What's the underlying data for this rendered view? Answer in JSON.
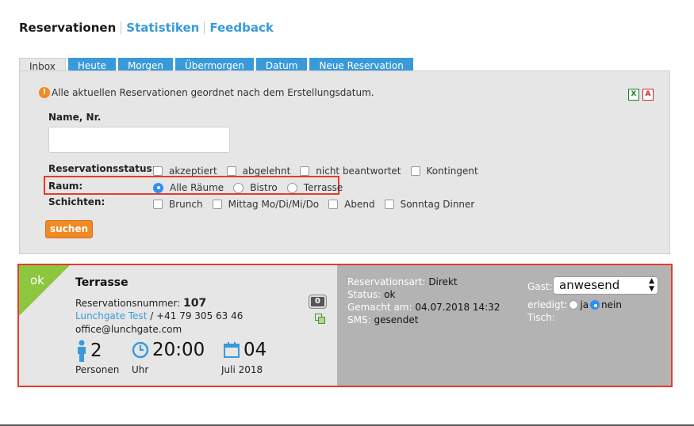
{
  "nav": {
    "items": [
      "Reservationen",
      "Statistiken",
      "Feedback"
    ]
  },
  "tabs": [
    "Inbox",
    "Heute",
    "Morgen",
    "Übermorgen",
    "Datum",
    "Neue Reservation"
  ],
  "filters": {
    "info_text": "Alle aktuellen Reservationen geordnet nach dem Erstellungsdatum.",
    "name_label": "Name, Nr.",
    "name_value": "",
    "status_label": "Reservationsstatus:",
    "status_options": [
      "akzeptiert",
      "abgelehnt",
      "nicht beantwortet",
      "Kontingent"
    ],
    "raum_label": "Raum:",
    "raum_options": [
      "Alle Räume",
      "Bistro",
      "Terrasse"
    ],
    "raum_selected": "Alle Räume",
    "schichten_label": "Schichten:",
    "schichten_options": [
      "Brunch",
      "Mittag Mo/Di/Mi/Do",
      "Abend",
      "Sonntag Dinner"
    ],
    "search_label": "suchen"
  },
  "reservation": {
    "status_badge": "ok",
    "room": "Terrasse",
    "number_label": "Reservationsnummer:",
    "number": "107",
    "guest_name": "Lunchgate Test",
    "phone": " / +41 79 305 63 46",
    "email": "office@lunchgate.com",
    "count_badge": "0",
    "persons": "2",
    "persons_label": "Personen",
    "time": "20:00",
    "time_label": "Uhr",
    "day": "04",
    "month_year": "Juli 2018",
    "details": {
      "art_label": "Reservationsart:",
      "art_value": "Direkt",
      "status_label": "Status:",
      "status_value": "ok",
      "created_label": "Gemacht am:",
      "created_value": "04.07.2018 14:32",
      "sms_label": "SMS:",
      "sms_value": "gesendet"
    },
    "gast_label": "Gast:",
    "gast_value": "anwesend",
    "erledigt_label": "erledigt:",
    "erledigt_options": [
      "ja",
      "nein"
    ],
    "erledigt_selected": "nein",
    "tisch_label": "Tisch:"
  },
  "colors": {
    "accent": "#3a9ad9",
    "ok_green": "#8dc63f",
    "button_orange": "#f08a24",
    "highlight_red": "#e53b2c"
  }
}
